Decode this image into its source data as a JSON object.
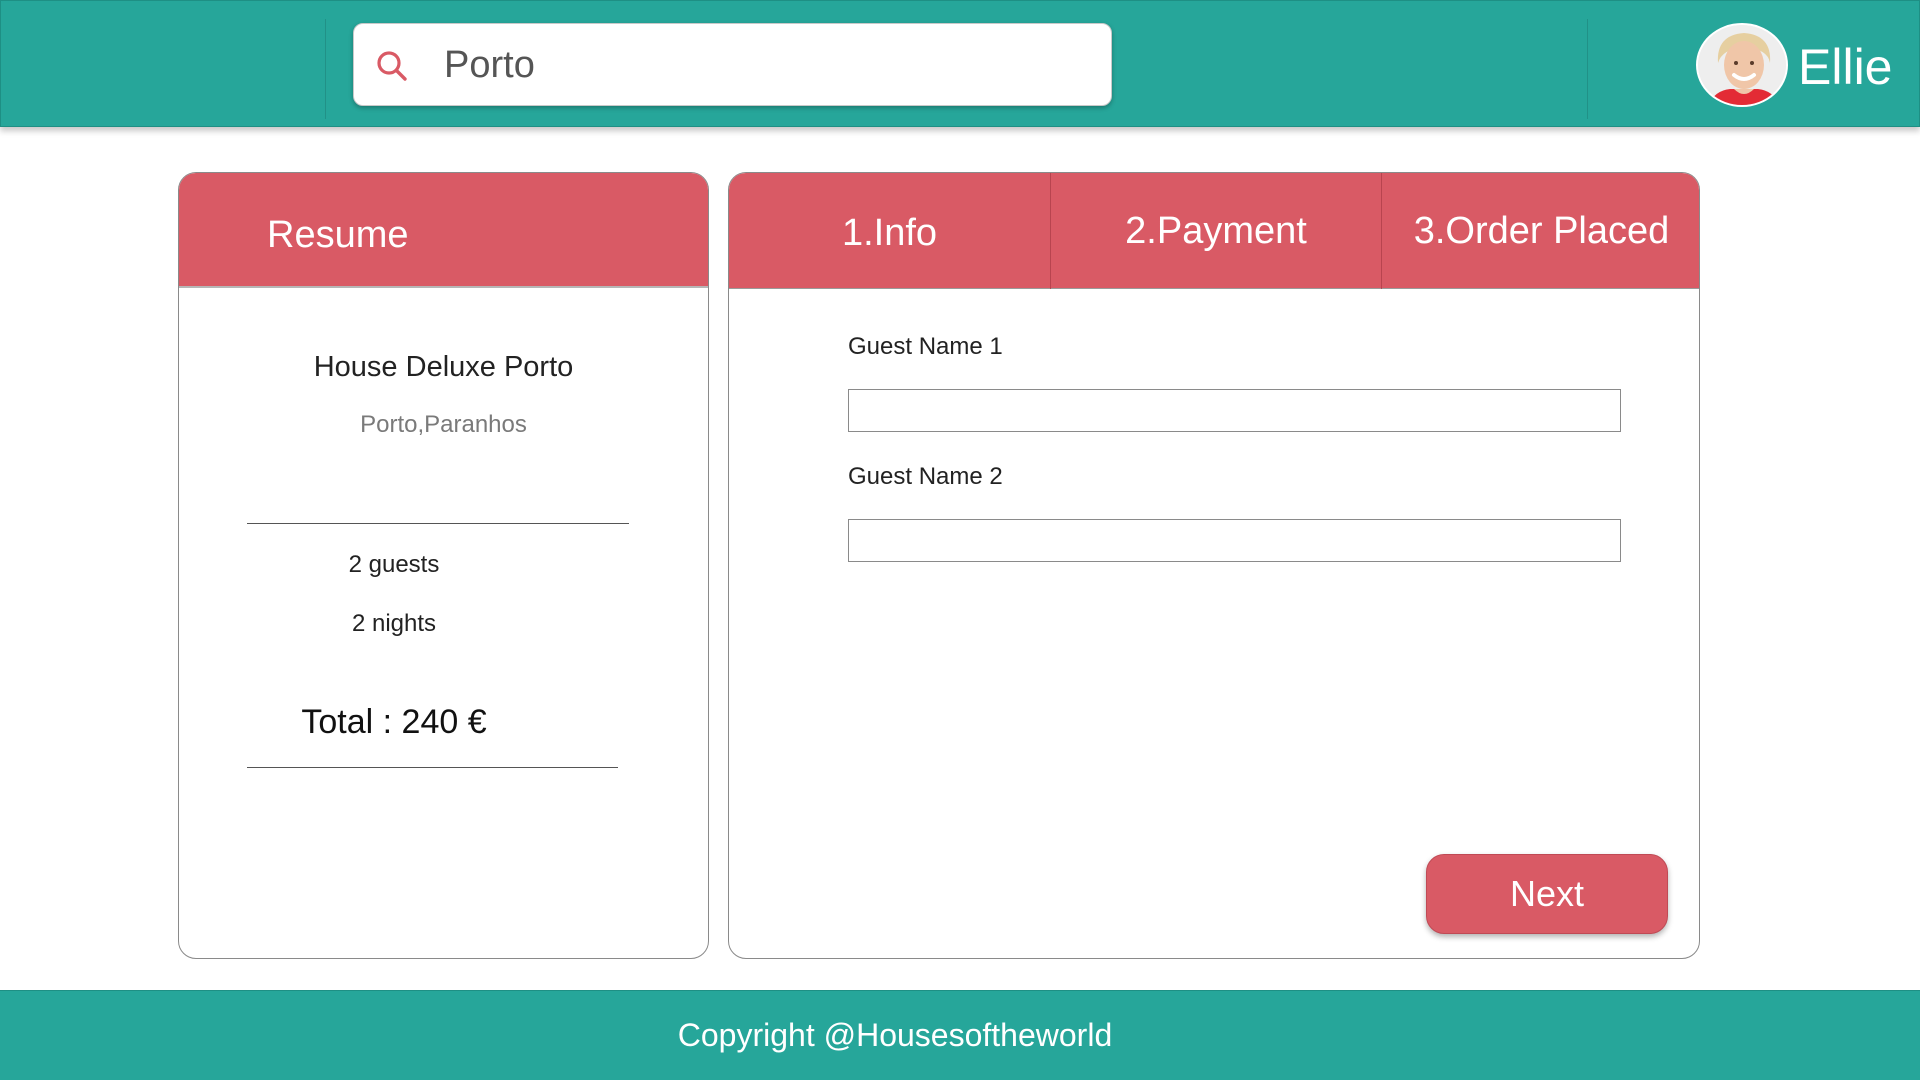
{
  "header": {
    "search": {
      "value": "Porto"
    },
    "user": {
      "name": "Ellie"
    }
  },
  "resume": {
    "title": "Resume",
    "property_name": "House Deluxe Porto",
    "location": "Porto,Paranhos",
    "guests": "2 guests",
    "nights": "2 nights",
    "total": "Total : 240 €"
  },
  "booking": {
    "tabs": [
      {
        "label": "1.Info"
      },
      {
        "label": "2.Payment"
      },
      {
        "label": "3.Order Placed"
      }
    ],
    "fields": [
      {
        "label": "Guest Name 1",
        "value": ""
      },
      {
        "label": "Guest Name 2",
        "value": ""
      }
    ],
    "next_label": "Next"
  },
  "footer": {
    "copyright": "Copyright @Housesoftheworld"
  },
  "colors": {
    "primary_teal": "#26a69a",
    "accent_red": "#d95a65"
  },
  "icons": {
    "search": "search-icon",
    "avatar": "user-avatar"
  }
}
